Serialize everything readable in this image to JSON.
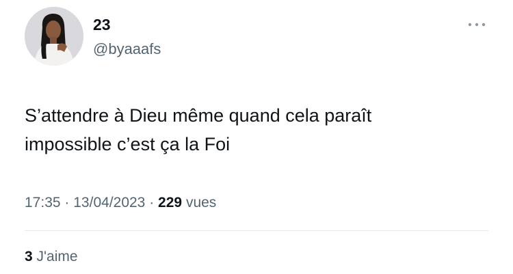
{
  "author": {
    "display_name": "23",
    "handle": "@byaaafs"
  },
  "tweet": {
    "text": "S’attendre à Dieu même quand cela paraît\nimpossible c’est ça la Foi",
    "time": "17:35",
    "date": "13/04/2023",
    "separator": "·",
    "views_count": "229",
    "views_label": "vues"
  },
  "engagement": {
    "likes_count": "3",
    "likes_label": "J'aime"
  },
  "icons": {
    "more": "more-horizontal-icon"
  },
  "colors": {
    "text_primary": "#0f1419",
    "text_secondary": "#536471",
    "divider": "#e6e9eb",
    "background": "#ffffff"
  }
}
